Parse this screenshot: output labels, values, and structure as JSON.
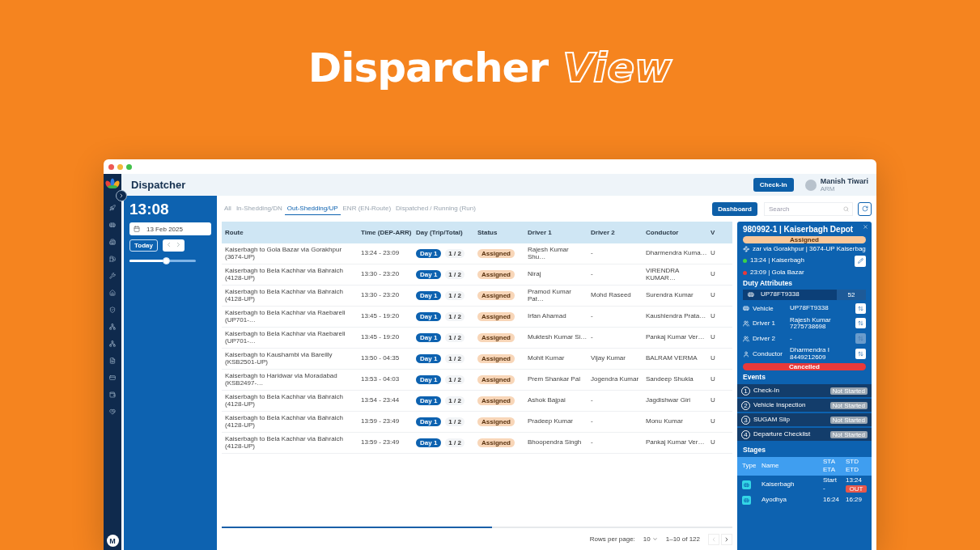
{
  "hero": {
    "title": "Disparcher",
    "title_outline": "View"
  },
  "app": {
    "title": "Dispatcher",
    "checkin_button": "Check-In",
    "user": {
      "name": "Manish Tiwari",
      "role": "ARM"
    },
    "sidebar_avatar": "M"
  },
  "clock": {
    "time": "13:08",
    "date": "13 Feb 2025",
    "today_button": "Today",
    "slider": {
      "level": 0.55
    }
  },
  "tabs": [
    {
      "label": "All",
      "selected": false
    },
    {
      "label": "In-Shedding/DN",
      "selected": false
    },
    {
      "label": "Out-Shedding/UP",
      "selected": true
    },
    {
      "label": "ENR (EN-Route)",
      "selected": false
    },
    {
      "label": "Dispatched / Running (Run)",
      "selected": false
    }
  ],
  "toolbar": {
    "dashboard_button": "Dashboard",
    "search": {
      "placeholder": "Search"
    }
  },
  "table": {
    "columns": [
      "Route",
      "Time (DEP-ARR)",
      "Day (Trip/Total)",
      "Status",
      "Driver 1",
      "Driver 2",
      "Conductor",
      "V"
    ],
    "rows": [
      {
        "route": "Kaiserbagh to Gola Bazar via Gorakhpur (3674-UP)",
        "time": "13:24 - 23:09",
        "day": "Day 1",
        "trip": "1 / 2",
        "status": "Assigned",
        "driver1": "Rajesh Kumar Shu…",
        "driver2": "-",
        "conductor": "Dharmendra Kuma…",
        "column_8": "U"
      },
      {
        "route": "Kaiserbagh to Bela Kachhar via Bahraich (4128-UP)",
        "time": "13:30 - 23:20",
        "day": "Day 1",
        "trip": "1 / 2",
        "status": "Assigned",
        "driver1": "Niraj",
        "driver2": "-",
        "conductor": "VIRENDRA KUMAR…",
        "column_8": "U"
      },
      {
        "route": "Kaiserbagh to Bela Kachhar via Bahraich (4128-UP)",
        "time": "13:30 - 23:20",
        "day": "Day 1",
        "trip": "1 / 2",
        "status": "Assigned",
        "driver1": "Pramod Kumar Pat…",
        "driver2": "Mohd Raseed",
        "conductor": "Surendra Kumar",
        "column_8": "U"
      },
      {
        "route": "Kaiserbagh to Bela Kachhar via Raebareli (UP701-…",
        "time": "13:45 - 19:20",
        "day": "Day 1",
        "trip": "1 / 2",
        "status": "Assigned",
        "driver1": "Irfan Ahamad",
        "driver2": "-",
        "conductor": "Kaushlendra Prata…",
        "column_8": "U"
      },
      {
        "route": "Kaiserbagh to Bela Kachhar via Raebareli (UP701-…",
        "time": "13:45 - 19:20",
        "day": "Day 1",
        "trip": "1 / 2",
        "status": "Assigned",
        "driver1": "Muktesh Kumar Si…",
        "driver2": "-",
        "conductor": "Pankaj Kumar Ver…",
        "column_8": "U"
      },
      {
        "route": "Kaiserbagh to Kaushambi via Bareilly (KSB2501-UP)",
        "time": "13:50 - 04:35",
        "day": "Day 1",
        "trip": "1 / 2",
        "status": "Assigned",
        "driver1": "Mohit Kumar",
        "driver2": "Vijay Kumar",
        "conductor": "BALRAM VERMA",
        "column_8": "U"
      },
      {
        "route": "Kaiserbagh to Haridwar via Moradabad (KSB2497-…",
        "time": "13:53 - 04:03",
        "day": "Day 1",
        "trip": "1 / 2",
        "status": "Assigned",
        "driver1": "Prem Shankar Pal",
        "driver2": "Jogendra Kumar",
        "conductor": "Sandeep Shukla",
        "column_8": "U"
      },
      {
        "route": "Kaiserbagh to Bela Kachhar via Bahraich (4128-UP)",
        "time": "13:54 - 23:44",
        "day": "Day 1",
        "trip": "1 / 2",
        "status": "Assigned",
        "driver1": "Ashok Bajpai",
        "driver2": "-",
        "conductor": "Jagdishwar Giri",
        "column_8": "U"
      },
      {
        "route": "Kaiserbagh to Bela Kachhar via Bahraich (4128-UP)",
        "time": "13:59 - 23:49",
        "day": "Day 1",
        "trip": "1 / 2",
        "status": "Assigned",
        "driver1": "Pradeep Kumar",
        "driver2": "-",
        "conductor": "Monu Kumar",
        "column_8": "U"
      },
      {
        "route": "Kaiserbagh to Bela Kachhar via Bahraich (4128-UP)",
        "time": "13:59 - 23:49",
        "day": "Day 1",
        "trip": "1 / 2",
        "status": "Assigned",
        "driver1": "Bhoopendra Singh",
        "driver2": "-",
        "conductor": "Pankaj Kumar Ver…",
        "column_8": "U"
      }
    ]
  },
  "pagination": {
    "rows_per_page_label": "Rows per page:",
    "rows_per_page": "10",
    "range": "1–10 of 122"
  },
  "detail": {
    "title": "980992-1 | Kaiserbagh Depot",
    "status": "Assigned",
    "route": "zar via Gorakhpur  |  3674-UP   Kaiserbag",
    "departure": "13:24 | Kaiserbagh",
    "arrival": "23:09 | Gola Bazar",
    "duty_heading": "Duty Attributes",
    "vehicle_bar": {
      "number": "UP78FT9338",
      "seats": "52"
    },
    "attributes": [
      {
        "kind": "vehicle",
        "label": "Vehicle",
        "value": "UP78FT9338",
        "disabled": false
      },
      {
        "kind": "driver",
        "label": "Driver 1",
        "value": "Rajesh Kumar",
        "phone": "7275738698",
        "disabled": false
      },
      {
        "kind": "driver",
        "label": "Driver 2",
        "value": "-",
        "disabled": true
      },
      {
        "kind": "conductor",
        "label": "Conductor",
        "value": "Dharmendra I",
        "phone": "8449212609",
        "disabled": false
      }
    ],
    "cancel_button": "Cancelled",
    "events_heading": "Events",
    "events": [
      {
        "number": "1",
        "label": "Check-In",
        "status": "Not Started"
      },
      {
        "number": "2",
        "label": "Vehicle Inspection",
        "status": "Not Started"
      },
      {
        "number": "3",
        "label": "SUGAM Slip",
        "status": "Not Started"
      },
      {
        "number": "4",
        "label": "Departure Checklist",
        "status": "Not Started"
      }
    ],
    "stages_heading": "Stages",
    "stage_columns": {
      "type": "Type",
      "name": "Name",
      "sta": "STA",
      "eta": "ETA",
      "std": "STD",
      "etd": "ETD"
    },
    "stages": [
      {
        "name": "Kaiserbagh",
        "sta": "Start",
        "eta": "-",
        "std": "13:24",
        "badge": "OUT"
      },
      {
        "name": "Ayodhya",
        "sta": "16:24",
        "std": "16:29"
      }
    ]
  }
}
